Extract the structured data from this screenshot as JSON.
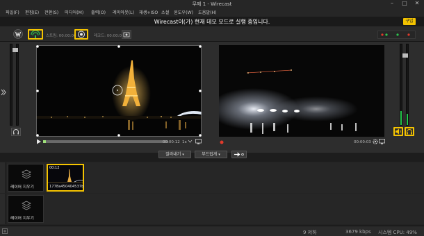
{
  "window": {
    "title": "무제 1 - Wirecast"
  },
  "menu": {
    "items": [
      "파일(F)",
      "편집(E)",
      "전환(S)",
      "미디어(M)",
      "출력(O)",
      "레이아웃(L)",
      "재생+ISO",
      "소셜",
      "윈도우(W)",
      "도움말(H)"
    ]
  },
  "banner": {
    "text": "Wirecast이(가) 현재 데모 모드로 실행 중입니다.",
    "buy_label": "구입"
  },
  "toolbar": {
    "stream_label": "스트림: 00:00:00",
    "record_label": "레코드: 00:00:00"
  },
  "preview": {
    "time_label": "00:00:12",
    "speed_label": "1x"
  },
  "live": {
    "time_label": "00:00:03"
  },
  "controls": {
    "cut_label": "잘라내기",
    "smooth_label": "부드럽게"
  },
  "layers": [
    {
      "label": "레이어 지우기",
      "shots": [
        {
          "time": "00:12",
          "label": "1778a450404537b"
        }
      ]
    },
    {
      "label": "레이어 지우기",
      "shots": []
    }
  ],
  "status": {
    "dropped": "9 저하",
    "bitrate": "3679 kbps",
    "cpu": "시스템 CPU: 49%"
  },
  "colors": {
    "accent": "#f5c400",
    "meter": "#23c54a",
    "record": "#e13a2b",
    "background": "#2d2d2d"
  }
}
